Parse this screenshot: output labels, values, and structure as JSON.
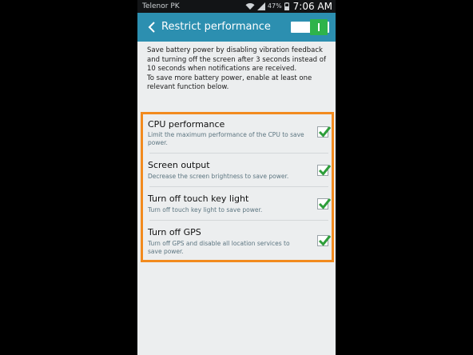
{
  "status_bar": {
    "carrier": "Telenor PK",
    "battery_percent": "47%",
    "time": "7:06 AM"
  },
  "action_bar": {
    "title": "Restrict performance",
    "back_icon": "chevron-left-icon",
    "switch_on": true
  },
  "description": {
    "line1": "Save battery power by disabling vibration feedback and turning off the screen after 3 seconds instead of 10 seconds when notifications are received.",
    "line2": "To save more battery power, enable at least one relevant function below."
  },
  "options": [
    {
      "title": "CPU performance",
      "subtitle": "Limit the maximum performance of the CPU to save power.",
      "checked": true
    },
    {
      "title": "Screen output",
      "subtitle": "Decrease the screen brightness to save power.",
      "checked": true
    },
    {
      "title": "Turn off touch key light",
      "subtitle": "Turn off touch key light to save power.",
      "checked": true
    },
    {
      "title": "Turn off GPS",
      "subtitle": "Turn off GPS and disable all location services to save power.",
      "checked": true
    }
  ],
  "colors": {
    "action_bar": "#2c8fb0",
    "switch_on": "#2eb34a",
    "highlight_border": "#f28a1e",
    "checkmark": "#2e9e3a"
  }
}
